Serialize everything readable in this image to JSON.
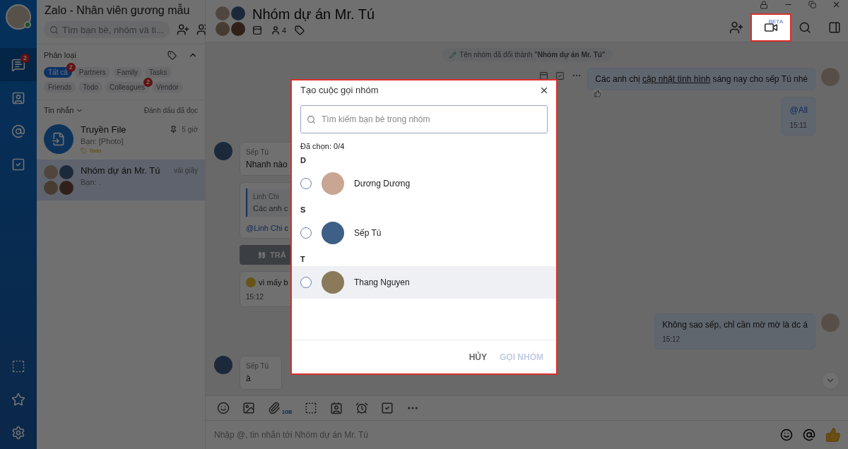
{
  "app_title": "Zalo - Nhân viên gương mẫu",
  "search": {
    "placeholder": "Tìm bạn bè, nhóm và ti..."
  },
  "nav": [
    {
      "kind": "chat",
      "badge": "2",
      "selected": true
    },
    {
      "kind": "contacts",
      "selected": false
    },
    {
      "kind": "mentions",
      "selected": false
    },
    {
      "kind": "todo",
      "selected": false
    }
  ],
  "nav_bottom": [
    {
      "kind": "capture"
    },
    {
      "kind": "star"
    },
    {
      "kind": "settings"
    }
  ],
  "filter": {
    "title": "Phân loại",
    "expanded": true,
    "tags": [
      {
        "label": "Tất cả",
        "selected": true,
        "badge": "2"
      },
      {
        "label": "Partners",
        "selected": false
      },
      {
        "label": "Family",
        "selected": false
      },
      {
        "label": "Tasks",
        "selected": false
      },
      {
        "label": "Friends",
        "selected": false
      },
      {
        "label": "Todo",
        "selected": false
      },
      {
        "label": "Colleagues",
        "selected": false,
        "badge": "2"
      },
      {
        "label": "Vendor",
        "selected": false
      }
    ]
  },
  "list_header": {
    "title": "Tin nhắn",
    "action": "Đánh dấu đã đọc"
  },
  "conversations": [
    {
      "kind": "file",
      "name": "Truyền File",
      "preview": "Bạn: [Photo]",
      "time": "5 giờ",
      "pinned": true,
      "tag": "Todo",
      "selected": false
    },
    {
      "kind": "group",
      "name": "Nhóm dự án Mr. Tú",
      "preview": "Bạn: .",
      "time": "vài giây",
      "pinned": false,
      "selected": true
    }
  ],
  "chat": {
    "title": "Nhóm dự án Mr. Tú",
    "member_count": "4",
    "video_call": {
      "badge": "BETA",
      "highlighted": true
    },
    "system_message": "Tên nhóm đã đổi thành **\"Nhóm dự án Mr. Tú\"**",
    "messages": [
      {
        "kind": "rich_text",
        "outgoing": true,
        "avatar": true,
        "reacted": true,
        "parts": [
          {
            "text": "Các anh chị ",
            "link": false
          },
          {
            "text": "cập nhật tình hình",
            "link": true
          },
          {
            "text": " sáng nay cho sếp Tú nhé",
            "link": false
          }
        ]
      },
      {
        "kind": "mention",
        "outgoing": true,
        "avatar": false,
        "text": "@All",
        "time": "15:11"
      },
      {
        "kind": "text",
        "outgoing": false,
        "avatar": true,
        "sender": "Sếp Tú",
        "text": "Nhanh nào"
      },
      {
        "kind": "quote",
        "outgoing": false,
        "avatar": false,
        "quoted_name": "Linh Chi",
        "quoted_text": "Các anh c",
        "mention": "@Linh Chi",
        "text": " c"
      },
      {
        "kind": "reply_button",
        "outgoing": false,
        "avatar": false,
        "text": "TRẢ"
      },
      {
        "kind": "emoji_text",
        "outgoing": false,
        "avatar": false,
        "text": "vì mấy b",
        "time": "15:12"
      },
      {
        "kind": "text",
        "outgoing": true,
        "avatar": true,
        "text": "Không sao sếp, chỉ cần mờ mờ là dc á",
        "time": "15:12"
      },
      {
        "kind": "text",
        "outgoing": false,
        "avatar": true,
        "sender": "Sếp Tú",
        "text": "à"
      }
    ]
  },
  "composer": {
    "file_limit": "1GB",
    "placeholder": "Nhập @, tin nhắn tới Nhóm dự án Mr. Tú"
  },
  "dialog": {
    "title": "Tạo cuộc gọi nhóm",
    "highlighted": true,
    "search_placeholder": "Tìm kiếm bạn bè trong nhóm",
    "selected_count": "Đã chọn:  0/4",
    "groups": [
      {
        "letter": "D",
        "members": [
          {
            "name": "Dương Dương",
            "checked": false,
            "hovered": false
          }
        ]
      },
      {
        "letter": "S",
        "members": [
          {
            "name": "Sếp Tú",
            "checked": false,
            "hovered": false
          }
        ]
      },
      {
        "letter": "T",
        "members": [
          {
            "name": "Thang Nguyen",
            "checked": false,
            "hovered": true
          }
        ]
      }
    ],
    "buttons": [
      {
        "label": "HỦY",
        "disabled": false
      },
      {
        "label": "GỌI NHÓM",
        "disabled": true
      }
    ]
  }
}
